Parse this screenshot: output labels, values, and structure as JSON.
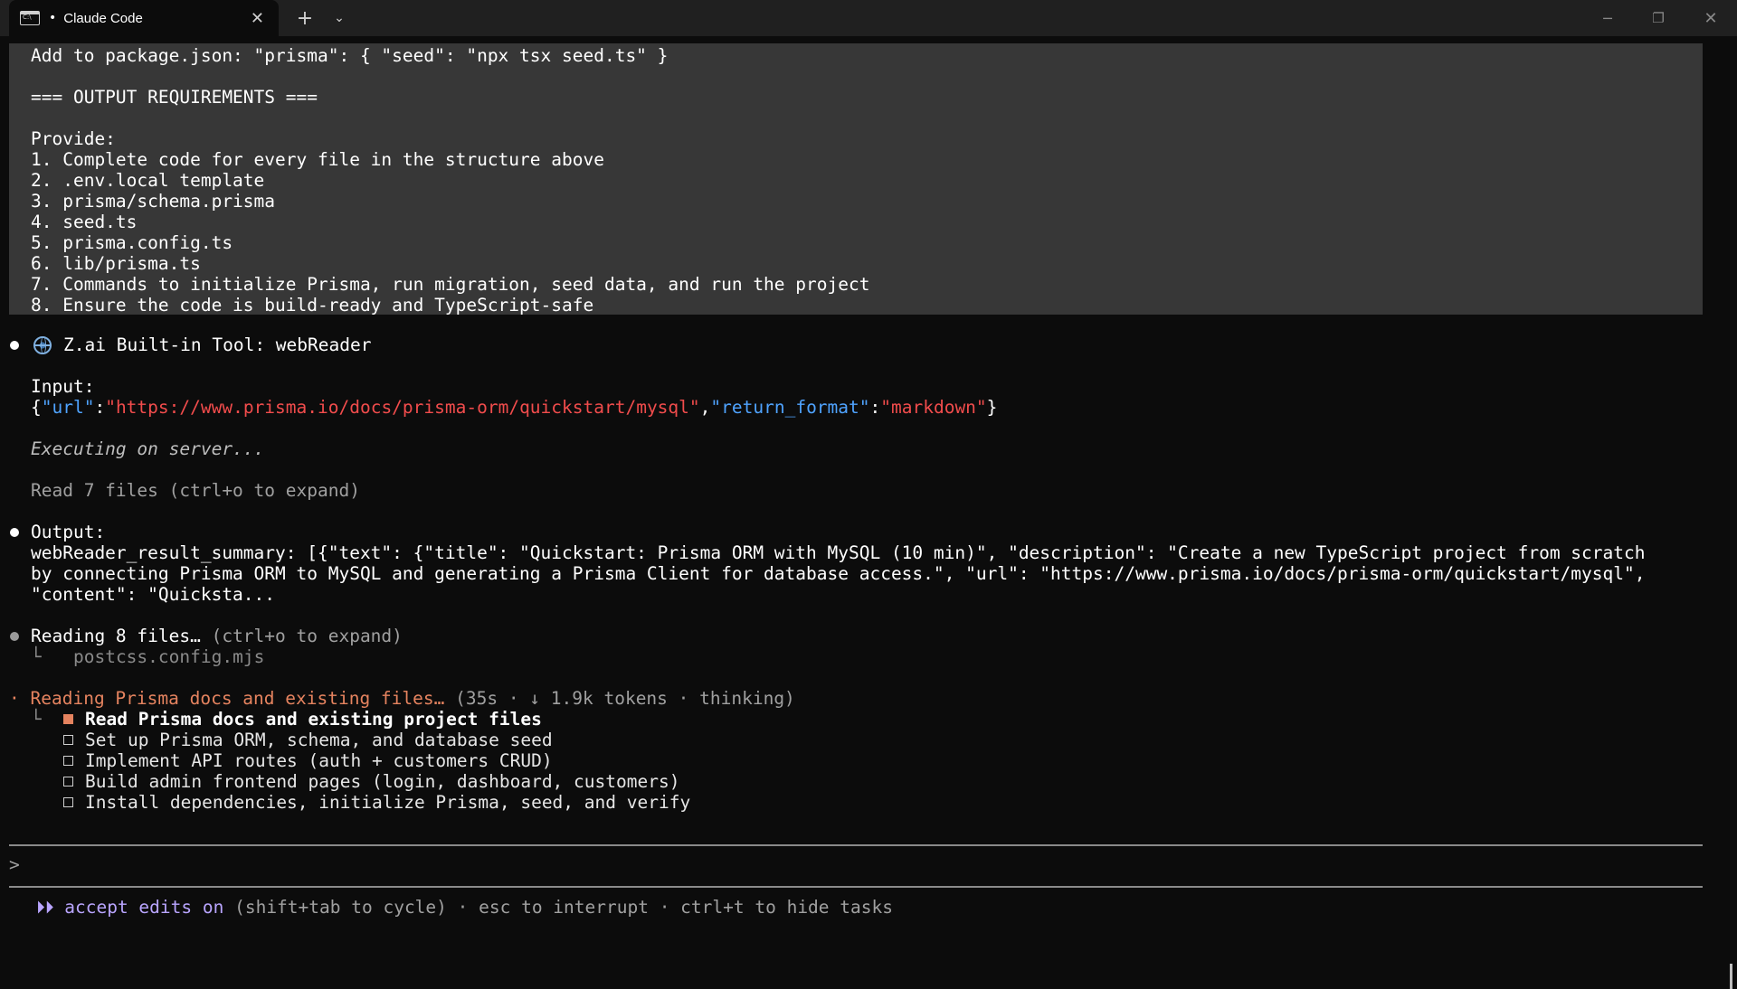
{
  "window": {
    "tab_title": "Claude Code",
    "tab_dot": "•",
    "icons": [
      "terminal-icon",
      "close-icon",
      "plus-icon",
      "chevron-down-icon",
      "minimize-icon",
      "maximize-icon",
      "window-close-icon"
    ]
  },
  "prompt_block": {
    "lines": [
      "Add to package.json: \"prisma\": { \"seed\": \"npx tsx seed.ts\" }",
      "=== OUTPUT REQUIREMENTS ===",
      "Provide:",
      "1. Complete code for every file in the structure above",
      "2. .env.local template",
      "3. prisma/schema.prisma",
      "4. seed.ts",
      "5. prisma.config.ts",
      "6. lib/prisma.ts",
      "7. Commands to initialize Prisma, run migration, seed data, and run the project",
      "8. Ensure the code is build-ready and TypeScript-safe"
    ]
  },
  "tool_call": {
    "title": "Z.ai Built-in Tool: webReader",
    "input_label": "Input:",
    "input_json": {
      "open_brace": "{",
      "key1": "\"url\"",
      "colon1": ":",
      "val1": "\"https://www.prisma.io/docs/prisma-orm/quickstart/mysql\"",
      "comma": ",",
      "key2": "\"return_format\"",
      "colon2": ":",
      "val2": "\"markdown\"",
      "close_brace": "}"
    },
    "executing": "Executing on server...",
    "read_files": "Read 7 files (ctrl+o to expand)"
  },
  "output": {
    "label": "Output:",
    "lines": [
      "webReader_result_summary: [{\"text\": {\"title\": \"Quickstart: Prisma ORM with MySQL (10 min)\", \"description\": \"Create a new TypeScript project from scratch",
      "by connecting Prisma ORM to MySQL and generating a Prisma Client for database access.\", \"url\": \"https://www.prisma.io/docs/prisma-orm/quickstart/mysql\",",
      "\"content\": \"Quicksta..."
    ]
  },
  "reading": {
    "label": "Reading 8 files…",
    "hint": " (ctrl+o to expand)",
    "branch": "└",
    "file": "postcss.config.mjs"
  },
  "status": {
    "spinner": "·",
    "activity": "Reading Prisma docs and existing files…",
    "meta": " (35s · ↓ 1.9k tokens · thinking)",
    "branch": "└"
  },
  "tasks": [
    {
      "label": "Read Prisma docs and existing project files",
      "state": "in_progress"
    },
    {
      "label": "Set up Prisma ORM, schema, and database seed",
      "state": "pending"
    },
    {
      "label": "Implement API routes (auth + customers CRUD)",
      "state": "pending"
    },
    {
      "label": "Build admin frontend pages (login, dashboard, customers)",
      "state": "pending"
    },
    {
      "label": "Install dependencies, initialize Prisma, seed, and verify",
      "state": "pending"
    }
  ],
  "input_prompt": ">",
  "footer": {
    "arrows": "⏵⏵",
    "mode": " accept edits on",
    "hint": " (shift+tab to cycle) · esc to interrupt · ctrl+t to hide tasks"
  },
  "colors": {
    "accent_orange": "#e5835f",
    "json_key_blue": "#4fa3ff",
    "json_value_red": "#f14c4c",
    "mode_purple": "#b9a5ff",
    "prompt_bg": "#373737"
  }
}
